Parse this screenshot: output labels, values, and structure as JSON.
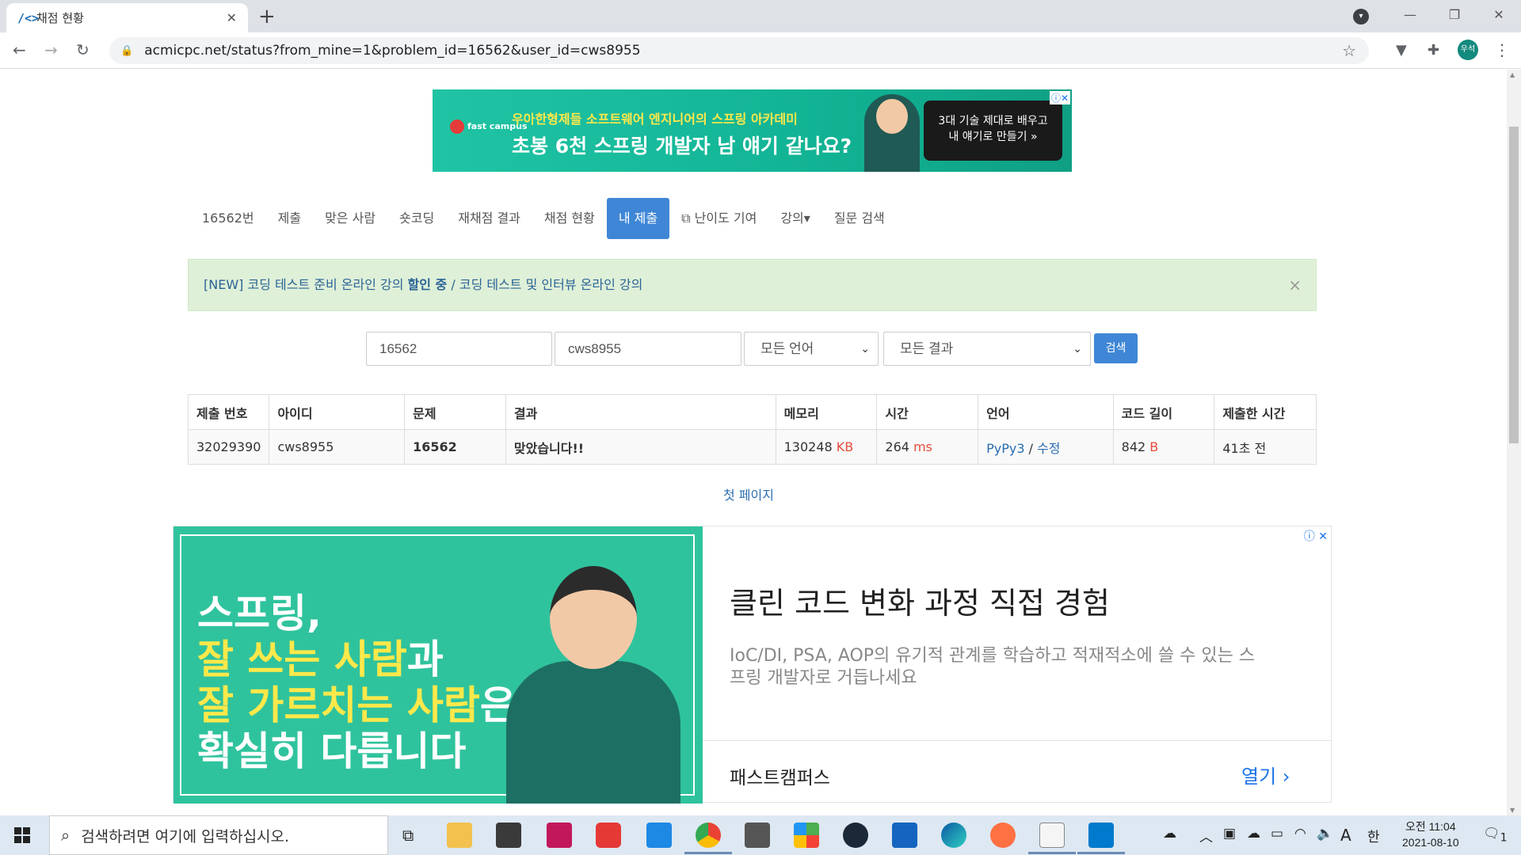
{
  "browser": {
    "tab_title": "채점 현황",
    "tab_favicon": "/<>",
    "url": "acmicpc.net/status?from_mine=1&problem_id=16562&user_id=cws8955",
    "profile_initial": "우석"
  },
  "top_ad": {
    "logo_text": "fast campus",
    "subtitle": "우아한형제들 소프트웨어 엔지니어의 스프링 아카데미",
    "headline": "초봉 6천 스프링 개발자 남 얘기 같나요?",
    "cta_line1": "3대 기술 제대로 배우고",
    "cta_line2": "내 얘기로 만들기 »"
  },
  "nav": {
    "items": [
      {
        "label": "16562번"
      },
      {
        "label": "제출"
      },
      {
        "label": "맞은 사람"
      },
      {
        "label": "숏코딩"
      },
      {
        "label": "재채점 결과"
      },
      {
        "label": "채점 현황"
      },
      {
        "label": "내 제출"
      },
      {
        "label": "난이도 기여"
      },
      {
        "label": "강의▾"
      },
      {
        "label": "질문 검색"
      }
    ]
  },
  "alert": {
    "prefix": "[NEW] 코딩 테스트 준비 온라인 강의 ",
    "highlight": "할인 중",
    "suffix": " / 코딩 테스트 및 인터뷰 온라인 강의",
    "close": "×"
  },
  "search": {
    "problem_id": "16562",
    "user_id": "cws8955",
    "language": "모든 언어",
    "result": "모든 결과",
    "button": "검색"
  },
  "table": {
    "headers": [
      "제출 번호",
      "아이디",
      "문제",
      "결과",
      "메모리",
      "시간",
      "언어",
      "코드 길이",
      "제출한 시간"
    ],
    "row": {
      "submission_id": "32029390",
      "user": "cws8955",
      "problem": "16562",
      "result": "맞았습니다!!",
      "memory": "130248",
      "memory_unit": "KB",
      "time": "264",
      "time_unit": "ms",
      "language": "PyPy3",
      "edit": "수정",
      "code_length": "842",
      "code_unit": "B",
      "submitted": "41초 전"
    }
  },
  "pagination": {
    "first_page": "첫 페이지"
  },
  "big_ad": {
    "img_line1": "스프링,",
    "img_line2_a": "잘 쓰는 사람",
    "img_line2_b": "과",
    "img_line3_a": "잘 가르치는 사람",
    "img_line3_b": "은",
    "img_line4": "확실히 다릅니다",
    "title": "클린 코드 변화 과정 직접 경험",
    "description": "IoC/DI, PSA, AOP의 유기적 관계를 학습하고 적재적소에 쓸 수 있는 스프링 개발자로 거듭나세요",
    "brand": "패스트캠퍼스",
    "open_label": "열기"
  },
  "taskbar": {
    "search_placeholder": "검색하려면 여기에 입력하십시오.",
    "ime_a": "A",
    "ime_lang": "한",
    "time": "오전 11:04",
    "date": "2021-08-10",
    "notification_count": "1"
  },
  "colors": {
    "accent_blue": "#3f87d6",
    "link_blue": "#2a6db0",
    "success_green": "#009874",
    "unit_red": "#e74c3c",
    "alert_bg": "#dff0d8"
  }
}
